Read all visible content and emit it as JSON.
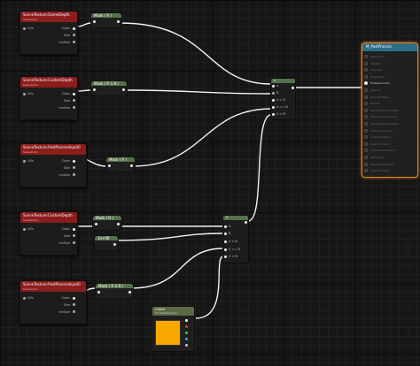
{
  "texture_nodes": [
    {
      "title": "SceneTexture:SceneDepth",
      "subtitle": "SceneColor",
      "input": "UVs",
      "outputs": [
        "Color",
        "Size",
        "InvSize"
      ]
    },
    {
      "title": "SceneTexture:CustomDepth",
      "subtitle": "SceneColor",
      "input": "UVs",
      "outputs": [
        "Color",
        "Size",
        "InvSize"
      ]
    },
    {
      "title": "SceneTexture:PostProcessInput0",
      "subtitle": "SceneColor",
      "input": "UVs",
      "outputs": [
        "Color",
        "Size",
        "InvSize"
      ]
    },
    {
      "title": "SceneTexture:CustomDepth",
      "subtitle": "SceneColor",
      "input": "UVs",
      "outputs": [
        "Color",
        "Size",
        "InvSize"
      ]
    },
    {
      "title": "SceneTexture:PostProcessInput0",
      "subtitle": "SceneColor",
      "input": "UVs",
      "outputs": [
        "Color",
        "Size",
        "InvSize"
      ]
    }
  ],
  "mask_nodes": [
    "Mask ( R )",
    "Mask ( R G B )",
    "Mask ( R )",
    "Mask ( R )",
    "1e+06",
    "Mask ( R G B )"
  ],
  "if_nodes": [
    {
      "label": "If",
      "pins": [
        "A",
        "B",
        "A > B",
        "A == B",
        "A < B"
      ]
    },
    {
      "label": "If",
      "pins": [
        "A",
        "B",
        "A > B",
        "A == B",
        "A < B"
      ]
    }
  ],
  "color_node": {
    "title": "Colour",
    "subtitle": "Constant4Vector",
    "color": "#f7a900",
    "pins": [
      "#ffffff",
      "#e04040",
      "#3fcf3f",
      "#4aa0ff",
      "#cccccc"
    ]
  },
  "result_node": {
    "title": "M_PostProcess",
    "items": [
      "Base Color",
      "Metallic",
      "Specular",
      "Roughness",
      "Emissive Color",
      "Opacity",
      "Opacity Mask",
      "Normal",
      "World Position Offset",
      "World Displacement",
      "Tessellation Multiplier",
      "Subsurface Color",
      "Custom Data 0",
      "Custom Data 1",
      "Ambient Occlusion",
      "Refraction",
      "Pixel Depth Offset",
      "Shading Model"
    ],
    "active_index": 4
  },
  "colors": {
    "texture_header": "#8c1d1d",
    "mask_header": "#56704a",
    "result_border": "#e08a1e",
    "result_header": "#2d6d86",
    "wire": "#ffffff"
  }
}
